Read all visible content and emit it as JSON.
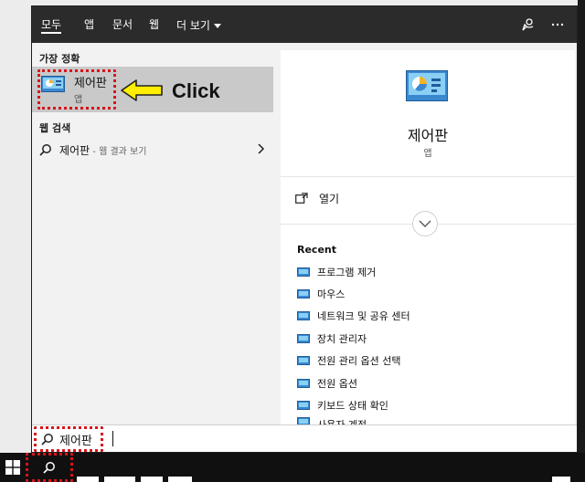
{
  "tabs": [
    {
      "label": "모두"
    },
    {
      "label": "앱"
    },
    {
      "label": "문서"
    },
    {
      "label": "웹"
    },
    {
      "label": "더 보기"
    }
  ],
  "left": {
    "best_match_heading": "가장 정확",
    "best_match_title": "제어판",
    "best_match_subtitle": "앱",
    "web_heading": "웹 검색",
    "web_query": "제어판",
    "web_suffix": " - 웹 결과 보기"
  },
  "annotation": {
    "click_text": "Click",
    "arrow_color": "#ffee00",
    "highlight_color": "#d8141a"
  },
  "right": {
    "app_title": "제어판",
    "app_subtitle": "앱",
    "open_label": "열기",
    "recent_heading": "Recent",
    "recent_items": [
      "프로그램 제거",
      "마우스",
      "네트워크 및 공유 센터",
      "장치 관리자",
      "전원 관리 옵션 선택",
      "전원 옵션",
      "키보드 상태 확인",
      "사용자 계정"
    ]
  },
  "search": {
    "value": "제어판"
  },
  "icons": [
    "feedback-icon",
    "more-icon",
    "control-panel-icon",
    "search-icon",
    "chevron-right-icon",
    "open-icon",
    "chevron-down-icon",
    "windows-icon"
  ],
  "colors": {
    "topbar": "#2b2b2b",
    "selected_row": "#c9c9c9",
    "pane_bg": "#f2f2f2",
    "taskbar": "#101010"
  }
}
